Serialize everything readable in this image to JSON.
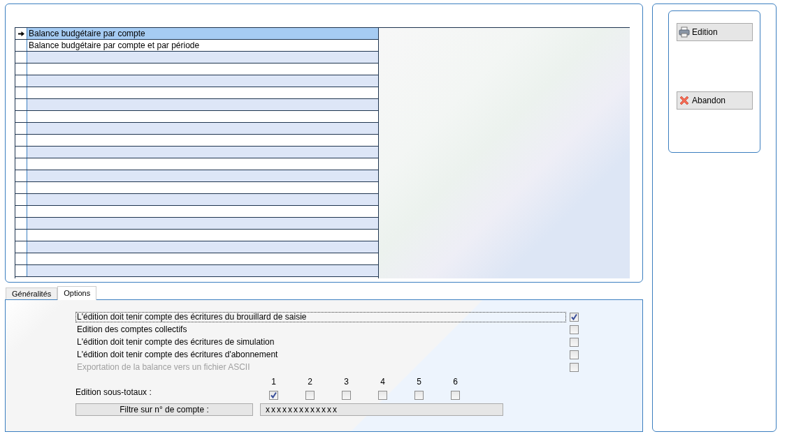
{
  "report_list": {
    "rows": [
      {
        "label": "Balance budgétaire par compte",
        "selected": true
      },
      {
        "label": "Balance budgétaire par compte et par période",
        "selected": false
      }
    ]
  },
  "actions": [
    {
      "kind": "print",
      "label": "Edition"
    },
    {
      "kind": "cancel",
      "label": "Abandon"
    }
  ],
  "tabs": [
    {
      "label": "Généralités",
      "selected": false
    },
    {
      "label": "Options",
      "selected": true
    }
  ],
  "options": [
    {
      "label": "L'édition doit tenir compte des écritures du brouillard de saisie",
      "checked": true,
      "disabled": false,
      "focused": true
    },
    {
      "label": "Edition des comptes collectifs",
      "checked": false,
      "disabled": false,
      "focused": false
    },
    {
      "label": "L'édition doit tenir compte des écritures de simulation",
      "checked": false,
      "disabled": false,
      "focused": false
    },
    {
      "label": "L'édition doit tenir compte des écritures d'abonnement",
      "checked": false,
      "disabled": false,
      "focused": false
    },
    {
      "label": "Exportation de la balance vers un fichier ASCII",
      "checked": false,
      "disabled": true,
      "focused": false
    }
  ],
  "subtotals": {
    "label": "Edition sous-totaux :",
    "levels": [
      {
        "label": "1",
        "checked": true
      },
      {
        "label": "2",
        "checked": false
      },
      {
        "label": "3",
        "checked": false
      },
      {
        "label": "4",
        "checked": false
      },
      {
        "label": "5",
        "checked": false
      },
      {
        "label": "6",
        "checked": false
      }
    ]
  },
  "account_filter": {
    "button": "Filtre sur n° de compte :",
    "value": "xxxxxxxxxxxxx"
  }
}
